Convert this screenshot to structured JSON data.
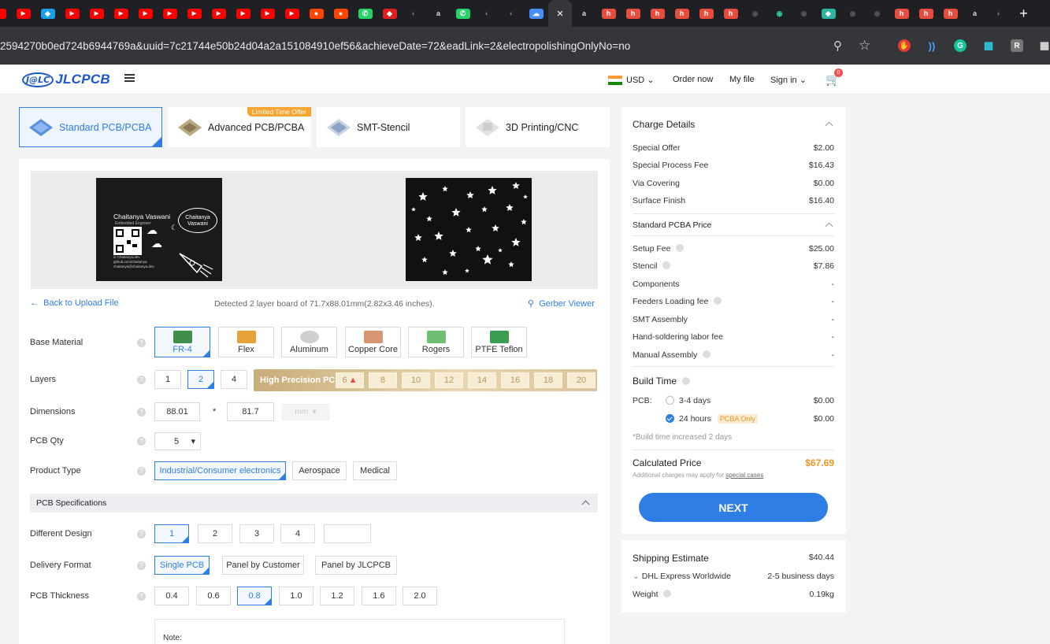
{
  "browser": {
    "url": "2594270b0ed724b6944769a&uuid=7c21744e50b24d04a2a151084910ef56&achieveDate=72&eadLink=2&electropolishingOnlyNo=no",
    "tabs": [
      {
        "icon": "youtube-icon",
        "color": "#ff0000"
      },
      {
        "icon": "app-icon",
        "color": "#1aa0e8"
      },
      {
        "icon": "youtube-icon",
        "color": "#ff0000"
      },
      {
        "icon": "youtube-icon",
        "color": "#ff0000"
      },
      {
        "icon": "youtube-icon",
        "color": "#ff0000"
      },
      {
        "icon": "youtube-icon",
        "color": "#ff0000"
      },
      {
        "icon": "youtube-icon",
        "color": "#ff0000"
      },
      {
        "icon": "youtube-icon",
        "color": "#ff0000"
      },
      {
        "icon": "youtube-icon",
        "color": "#ff0000"
      },
      {
        "icon": "youtube-icon",
        "color": "#ff0000"
      },
      {
        "icon": "youtube-icon",
        "color": "#ff0000"
      },
      {
        "icon": "youtube-icon",
        "color": "#ff0000"
      },
      {
        "icon": "reddit-icon",
        "color": "#ff4500"
      },
      {
        "icon": "reddit-icon",
        "color": "#ff4500"
      },
      {
        "icon": "whatsapp-icon",
        "color": "#25d366"
      },
      {
        "icon": "diamond-icon",
        "color": "#e02020"
      },
      {
        "icon": "globe-icon",
        "color": "#777"
      },
      {
        "icon": "translate-icon",
        "color": "#ddd"
      },
      {
        "icon": "whatsapp-icon",
        "color": "#25d366"
      },
      {
        "icon": "globe-icon",
        "color": "#777"
      },
      {
        "icon": "globe-icon",
        "color": "#777"
      },
      {
        "icon": "chat-icon",
        "color": "#4b8df8"
      }
    ],
    "active_tab_close": "×",
    "tabs_after": [
      {
        "icon": "translate-icon",
        "color": "#ddd"
      },
      {
        "icon": "h-icon",
        "color": "#e84c3d"
      },
      {
        "icon": "h-icon",
        "color": "#e84c3d"
      },
      {
        "icon": "h-icon",
        "color": "#e84c3d"
      },
      {
        "icon": "h-icon",
        "color": "#e84c3d"
      },
      {
        "icon": "h-icon",
        "color": "#e84c3d"
      },
      {
        "icon": "h-icon",
        "color": "#e84c3d"
      },
      {
        "icon": "github-icon",
        "color": "#555"
      },
      {
        "icon": "github-icon",
        "color": "#3c9"
      },
      {
        "icon": "github-icon",
        "color": "#555"
      },
      {
        "icon": "app-icon",
        "color": "#2bb5a0"
      },
      {
        "icon": "github-icon",
        "color": "#555"
      },
      {
        "icon": "github-icon",
        "color": "#555"
      },
      {
        "icon": "h-icon",
        "color": "#e84c3d"
      },
      {
        "icon": "h-icon",
        "color": "#e84c3d"
      },
      {
        "icon": "h-icon",
        "color": "#e84c3d"
      },
      {
        "icon": "translate-icon",
        "color": "#ddd"
      },
      {
        "icon": "globe-icon",
        "color": "#777"
      }
    ],
    "new_tab": "+"
  },
  "header": {
    "logo_badge": "J@LC",
    "logo_text": "JLCPCB",
    "currency": "USD",
    "order_now": "Order now",
    "my_file": "My file",
    "sign_in": "Sign in",
    "cart_count": "0"
  },
  "product_tabs": [
    {
      "label": "Standard PCB/PCBA",
      "active": true
    },
    {
      "label": "Advanced PCB/PCBA",
      "ribbon": "Limited Time Offer"
    },
    {
      "label": "SMT-Stencil"
    },
    {
      "label": "3D Printing/CNC"
    }
  ],
  "preview": {
    "board1_name": "Chaitanya Vaswani",
    "board1_sub": "Embedded Engineer",
    "board1_bubble": "Chaitanya\nVaswani",
    "board1_links": [
      "in Chaitanya.dev",
      "github.com/chaitanya",
      "chaitanya@chaitanya.dev"
    ],
    "back_link": "Back to Upload File",
    "detected": "Detected 2 layer board of 71.7x88.01mm(2.82x3.46 inches).",
    "gerber_viewer": "Gerber Viewer"
  },
  "form": {
    "base_material": {
      "label": "Base Material",
      "options": [
        "FR-4",
        "Flex",
        "Aluminum",
        "Copper Core",
        "Rogers",
        "PTFE Teflon"
      ],
      "selected": "FR-4"
    },
    "layers": {
      "label": "Layers",
      "options": [
        "1",
        "2",
        "4"
      ],
      "selected": "2",
      "high_precision_label": "High Precision PCB",
      "hp_options": [
        "6",
        "8",
        "10",
        "12",
        "14",
        "16",
        "18",
        "20"
      ]
    },
    "dimensions": {
      "label": "Dimensions",
      "width": "88.01",
      "x": "*",
      "height": "81.7",
      "unit": "mm"
    },
    "pcb_qty": {
      "label": "PCB Qty",
      "value": "5"
    },
    "product_type": {
      "label": "Product Type",
      "options": [
        "Industrial/Consumer electronics",
        "Aerospace",
        "Medical"
      ],
      "selected": "Industrial/Consumer electronics"
    },
    "section_title": "PCB Specifications",
    "different_design": {
      "label": "Different Design",
      "options": [
        "1",
        "2",
        "3",
        "4",
        ""
      ],
      "selected": "1"
    },
    "delivery_format": {
      "label": "Delivery Format",
      "options": [
        "Single PCB",
        "Panel by Customer",
        "Panel by JLCPCB"
      ],
      "selected": "Single PCB"
    },
    "pcb_thickness": {
      "label": "PCB Thickness",
      "options": [
        "0.4",
        "0.6",
        "0.8",
        "1.0",
        "1.2",
        "1.6",
        "2.0"
      ],
      "selected": "0.8"
    },
    "note_label": "Note:"
  },
  "charges": {
    "title": "Charge Details",
    "rows": [
      {
        "label": "Special Offer",
        "value": "$2.00"
      },
      {
        "label": "Special Process Fee",
        "value": "$16.43"
      },
      {
        "label": "Via Covering",
        "value": "$0.00"
      },
      {
        "label": "Surface Finish",
        "value": "$16.40"
      }
    ],
    "pcba_title": "Standard PCBA Price",
    "pcba_rows": [
      {
        "label": "Setup Fee",
        "value": "$25.00"
      },
      {
        "label": "Stencil",
        "value": "$7.86"
      },
      {
        "label": "Components",
        "value": "-"
      },
      {
        "label": "Feeders Loading fee",
        "value": "-"
      },
      {
        "label": "SMT Assembly",
        "value": "-"
      },
      {
        "label": "Hand-soldering labor fee",
        "value": "-"
      },
      {
        "label": "Manual Assembly",
        "value": "-"
      }
    ],
    "build_time_title": "Build Time",
    "pcb_label": "PCB:",
    "build_options": [
      {
        "label": "3-4 days",
        "value": "$0.00"
      },
      {
        "label": "24 hours",
        "value": "$0.00",
        "tag": "PCBA Only"
      }
    ],
    "build_note": "*Build time increased 2 days",
    "calc_label": "Calculated Price",
    "calc_value": "$67.69",
    "calc_note": "Additional charges may apply for",
    "calc_link": "special cases",
    "next": "NEXT"
  },
  "shipping": {
    "title": "Shipping Estimate",
    "value": "$40.44",
    "method": "DHL Express Worldwide",
    "days": "2-5 business days",
    "weight_label": "Weight",
    "weight": "0.19kg"
  },
  "colors": {
    "accent": "#2f7ee6",
    "price": "#f7931e",
    "ribbon": "#f7a531"
  }
}
